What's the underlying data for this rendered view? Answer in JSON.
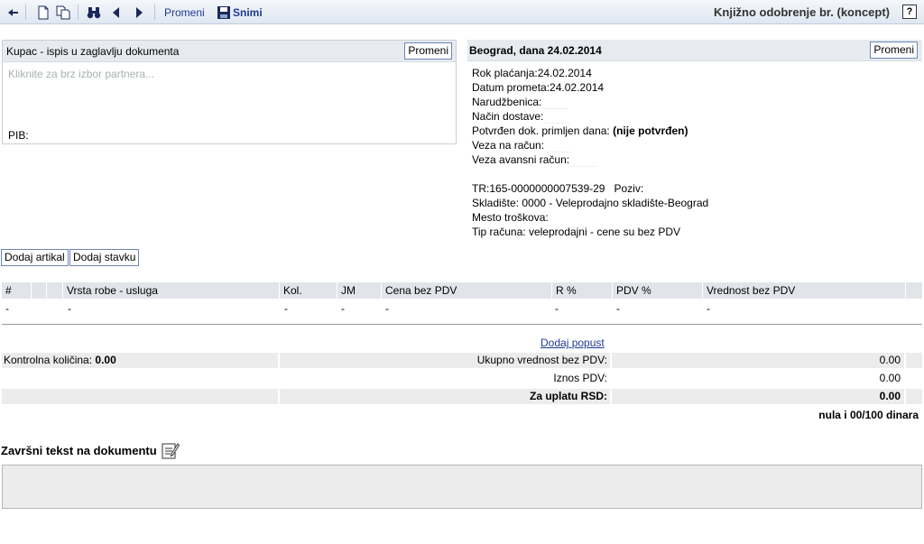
{
  "toolbar": {
    "edit_label": "Promeni",
    "save_label": "Snimi",
    "title": "Knjižno odobrenje br. (koncept)",
    "help": "?"
  },
  "buyer": {
    "title": "Kupac - ispis u zaglavlju dokumenta",
    "edit_label": "Promeni",
    "placeholder": "Kliknite za brz izbor partnera...",
    "pib_label": "PIB:"
  },
  "header": {
    "title": "Beograd, dana 24.02.2014",
    "edit_label": "Promeni",
    "fields": {
      "rok_label": "Rok plaćanja:",
      "rok_value": "24.02.2014",
      "datum_label": "Datum prometa:",
      "datum_value": "24.02.2014",
      "narudzbenica_label": "Narudžbenica:",
      "nacin_label": "Način dostave:",
      "potvrdjen_label": "Potvrđen dok. primljen dana:",
      "potvrdjen_value": "(nije potvrđen)",
      "veza_label": "Veza na račun:",
      "veza_avans_label": "Veza avansni račun:",
      "tr_label": "TR:",
      "tr_value": "165-0000000007539-29",
      "poziv_label": "Poziv:",
      "skladiste_label": "Skladište:",
      "skladiste_value": "0000 - Veleprodajno skladište-Beograd",
      "mesto_label": "Mesto troškova:",
      "tip_label": "Tip računa:",
      "tip_value": "veleprodajni - cene su bez PDV"
    }
  },
  "actions": {
    "add_article": "Dodaj artikal",
    "add_item": "Dodaj stavku"
  },
  "table": {
    "columns": [
      "#",
      "",
      "",
      "Vrsta robe - usluga",
      "Kol.",
      "JM",
      "Cena bez PDV",
      "R %",
      "PDV %",
      "Vrednost bez PDV",
      ""
    ],
    "row": [
      "-",
      "-",
      "-",
      "-",
      "-",
      "-",
      "-",
      "-"
    ]
  },
  "summary": {
    "add_discount": "Dodaj popust",
    "control_qty_label": "Kontrolna količina:",
    "control_qty_value": "0.00",
    "total_no_vat_label": "Ukupno vrednost bez PDV:",
    "total_no_vat_value": "0.00",
    "vat_label": "Iznos PDV:",
    "vat_value": "0.00",
    "pay_label": "Za uplatu RSD:",
    "pay_value": "0.00",
    "words": "nula i 00/100 dinara"
  },
  "final": {
    "title": "Završni tekst na dokumentu"
  },
  "colors": {
    "accent": "#1f3a93",
    "button_border": "#6b86b9",
    "panel_header": "#e7ebf0"
  }
}
